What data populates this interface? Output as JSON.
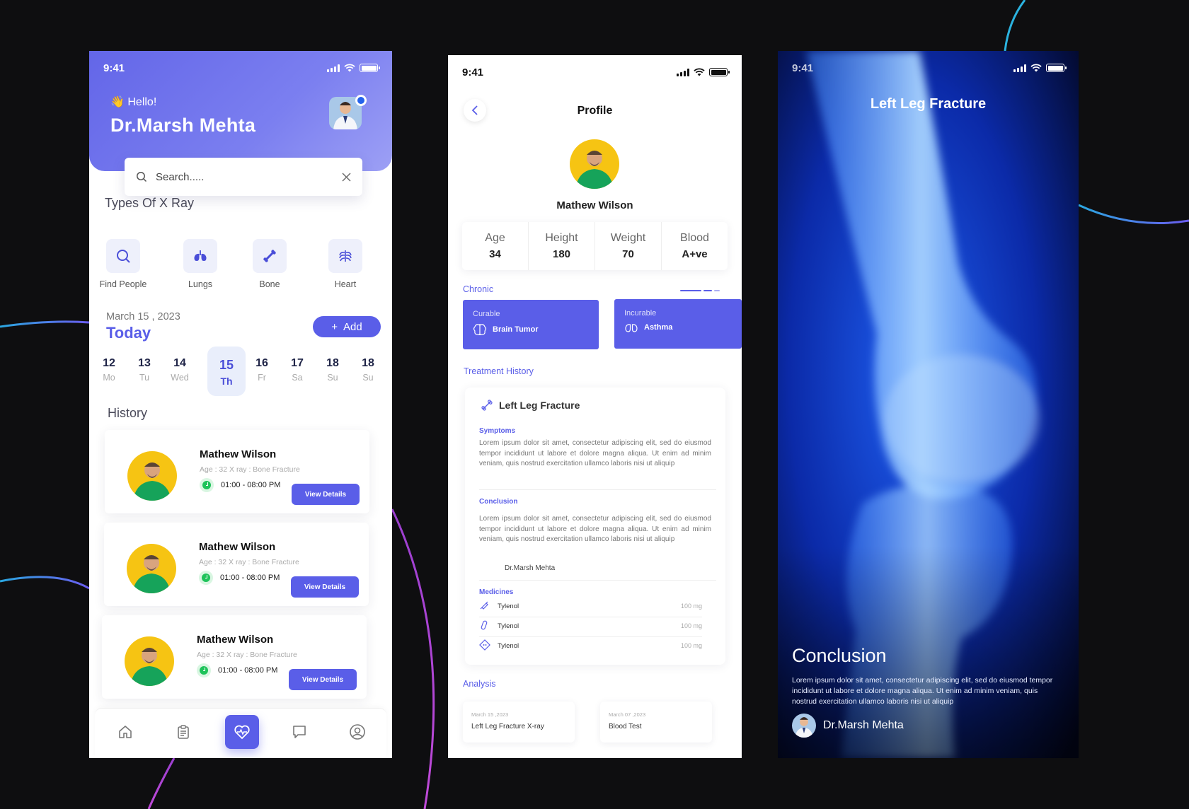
{
  "colors": {
    "accent": "#5a5ee8",
    "background": "#0e0e10",
    "green": "#1ec35a",
    "avatar_bg": "#f6c413"
  },
  "home": {
    "status_time": "9:41",
    "greeting": "👋 Hello!",
    "doctor_name": "Dr.Marsh Mehta",
    "search_placeholder": "Search.....",
    "xray_section_title": "Types Of X Ray",
    "xray_types": [
      {
        "label": "Find People",
        "icon": "search-icon"
      },
      {
        "label": "Lungs",
        "icon": "lungs-icon"
      },
      {
        "label": "Bone",
        "icon": "bone-icon"
      },
      {
        "label": "Heart",
        "icon": "ribcage-icon"
      }
    ],
    "date": "March 15 , 2023",
    "today_label": "Today",
    "add_label": "Add",
    "days": [
      {
        "num": "12",
        "wd": "Mo"
      },
      {
        "num": "13",
        "wd": "Tu"
      },
      {
        "num": "14",
        "wd": "Wed"
      },
      {
        "num": "15",
        "wd": "Th",
        "selected": true
      },
      {
        "num": "16",
        "wd": "Fr"
      },
      {
        "num": "17",
        "wd": "Sa"
      },
      {
        "num": "18",
        "wd": "Su"
      },
      {
        "num": "18",
        "wd": "Su"
      }
    ],
    "history_title": "History",
    "history": [
      {
        "name": "Mathew Wilson",
        "meta": "Age : 32 X ray : Bone Fracture",
        "time": "01:00 - 08:00 PM",
        "button": "View Details"
      },
      {
        "name": "Mathew Wilson",
        "meta": "Age : 32 X ray : Bone Fracture",
        "time": "01:00 - 08:00 PM",
        "button": "View Details"
      },
      {
        "name": "Mathew Wilson",
        "meta": "Age : 32 X ray : Bone Fracture",
        "time": "01:00 - 08:00 PM",
        "button": "View Details"
      }
    ],
    "nav": [
      "home-icon",
      "clipboard-icon",
      "heart-pulse-icon",
      "chat-icon",
      "profile-icon"
    ]
  },
  "profile": {
    "status_time": "9:41",
    "title": "Profile",
    "patient_name": "Mathew Wilson",
    "stats": [
      {
        "k": "Age",
        "v": "34"
      },
      {
        "k": "Height",
        "v": "180"
      },
      {
        "k": "Weight",
        "v": "70"
      },
      {
        "k": "Blood",
        "v": "A+ve"
      }
    ],
    "chronic_label": "Chronic",
    "chronic": [
      {
        "type": "Curable",
        "disease": "Brain Tumor",
        "icon": "brain-icon"
      },
      {
        "type": "Incurable",
        "disease": "Asthma",
        "icon": "lungs-icon"
      }
    ],
    "treatment_label": "Treatment History",
    "treatment": {
      "title": "Left Leg Fracture",
      "symptoms_label": "Symptoms",
      "symptoms_text": "Lorem ipsum dolor sit amet, consectetur adipiscing elit, sed do eiusmod tempor incididunt ut labore et dolore magna aliqua. Ut enim ad minim veniam, quis nostrud exercitation ullamco laboris nisi ut aliquip",
      "conclusion_label": "Conclusion",
      "conclusion_text": "Lorem ipsum dolor sit amet, consectetur adipiscing elit, sed do eiusmod tempor incididunt ut labore et dolore magna aliqua. Ut enim ad minim veniam, quis nostrud exercitation ullamco laboris nisi ut aliquip",
      "signed_by": "Dr.Marsh Mehta",
      "medicines_label": "Medicines",
      "medicines": [
        {
          "name": "Tylenol",
          "dose": "100 mg",
          "icon": "syringe-icon"
        },
        {
          "name": "Tylenol",
          "dose": "100 mg",
          "icon": "capsule-icon"
        },
        {
          "name": "Tylenol",
          "dose": "100 mg",
          "icon": "pill-pack-icon"
        }
      ]
    },
    "analysis_label": "Analysis",
    "analysis": [
      {
        "date": "March 15 ,2023",
        "name": "Left Leg Fracture X-ray"
      },
      {
        "date": "March 07 ,2023",
        "name": "Blood Test"
      }
    ]
  },
  "xray_view": {
    "status_time": "9:41",
    "title": "Left Leg Fracture",
    "conclusion_title": "Conclusion",
    "conclusion_text": "Lorem ipsum dolor sit amet, consectetur adipiscing elit, sed do eiusmod tempor incididunt ut labore et dolore magna aliqua. Ut enim ad minim veniam, quis nostrud exercitation ullamco laboris nisi ut aliquip",
    "doctor_name": "Dr.Marsh Mehta"
  }
}
